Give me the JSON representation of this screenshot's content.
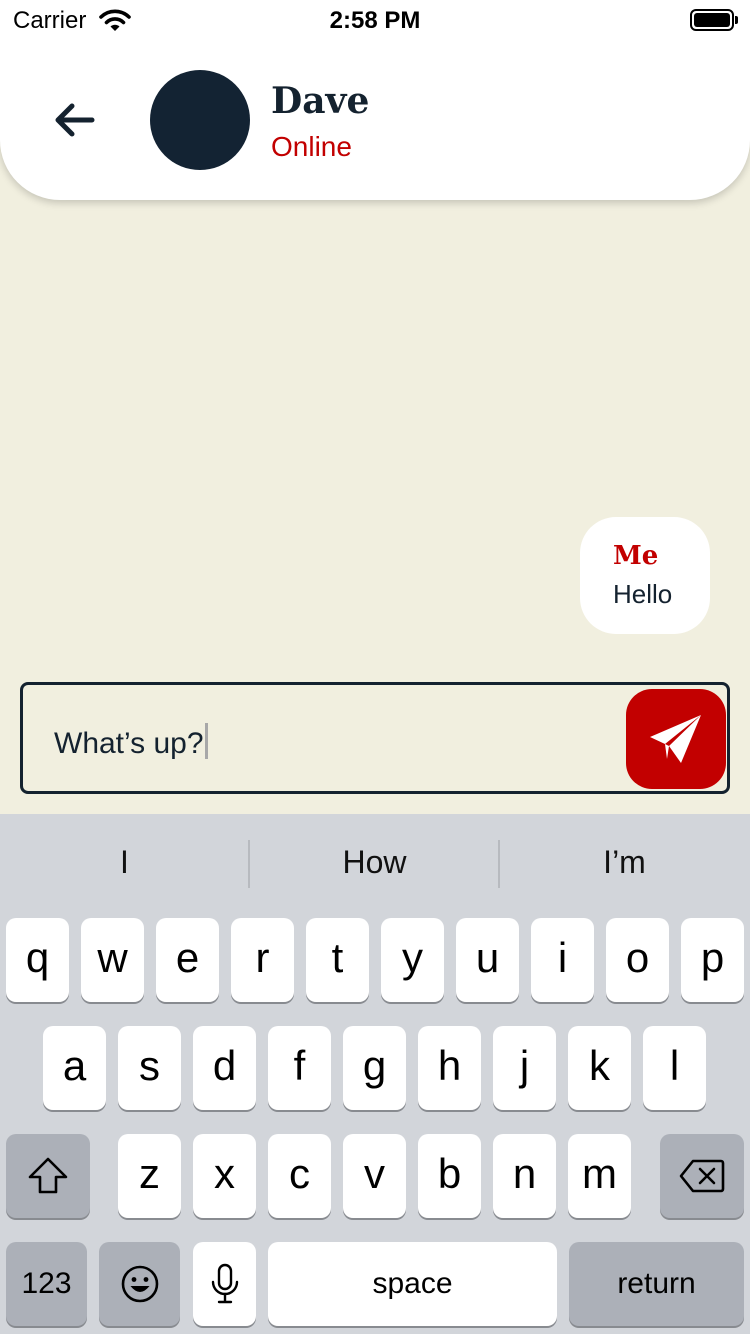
{
  "status_bar": {
    "carrier": "Carrier",
    "time": "2:58 PM"
  },
  "header": {
    "name": "Dave",
    "status": "Online",
    "back_icon": "arrow-left-icon"
  },
  "colors": {
    "accent": "#c20000",
    "dark": "#14222f",
    "background": "#f1efdf"
  },
  "messages": [
    {
      "sender": "Me",
      "text": "Hello"
    }
  ],
  "composer": {
    "value": "What’s up?",
    "send_icon": "paper-plane-icon"
  },
  "keyboard": {
    "suggestions": [
      "I",
      "How",
      "I’m"
    ],
    "row1": [
      "q",
      "w",
      "e",
      "r",
      "t",
      "y",
      "u",
      "i",
      "o",
      "p"
    ],
    "row2": [
      "a",
      "s",
      "d",
      "f",
      "g",
      "h",
      "j",
      "k",
      "l"
    ],
    "row3": [
      "z",
      "x",
      "c",
      "v",
      "b",
      "n",
      "m"
    ],
    "numbers_label": "123",
    "space_label": "space",
    "return_label": "return"
  }
}
